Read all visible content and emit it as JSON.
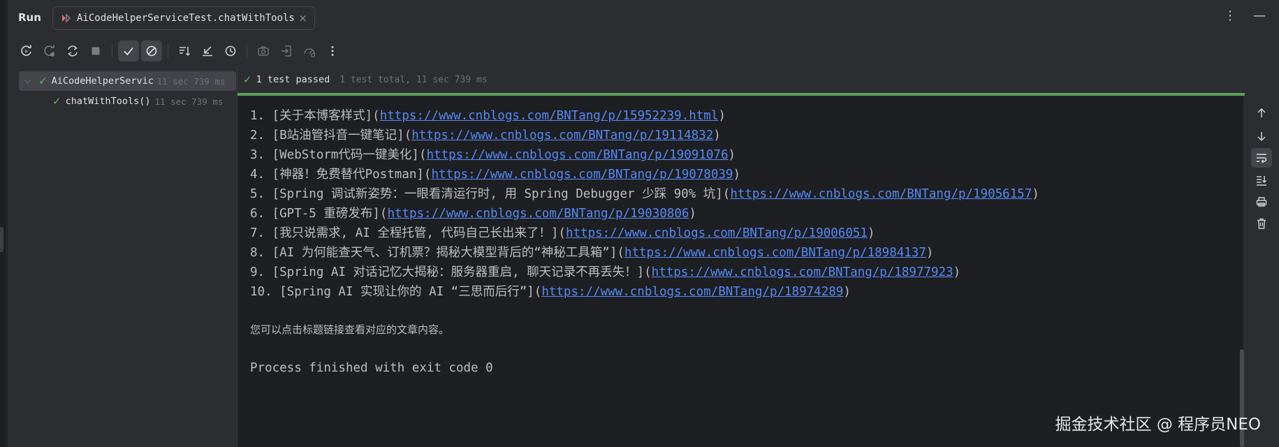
{
  "header": {
    "run_label": "Run",
    "tab_label": "AiCodeHelperServiceTest.chatWithTools",
    "close_glyph": "×",
    "more_glyph": "⋮",
    "minimize_glyph": "—"
  },
  "toolbar": {
    "buttons": [
      {
        "icon": "rerun-icon"
      },
      {
        "icon": "rerun-failed-icon"
      },
      {
        "icon": "toggle-auto-test-icon"
      },
      {
        "icon": "stop-icon"
      },
      {
        "icon": "show-passed-icon",
        "active": true
      },
      {
        "icon": "show-ignored-icon",
        "active": true
      },
      {
        "icon": "sort-alphabetically-icon"
      },
      {
        "icon": "sort-by-duration-icon"
      },
      {
        "icon": "history-icon"
      },
      {
        "icon": "camera-icon"
      },
      {
        "icon": "import-tests-icon"
      },
      {
        "icon": "coverage-icon"
      },
      {
        "icon": "more-options-icon"
      }
    ]
  },
  "tree": {
    "root": {
      "name": "AiCodeHelperServiceTest",
      "duration": "11 sec 739 ms"
    },
    "child": {
      "name": "chatWithTools()",
      "duration": "11 sec 739 ms"
    }
  },
  "status": {
    "passed": "1 test passed",
    "total": "1 test total, 11 sec 739 ms"
  },
  "console": {
    "items": [
      {
        "prefix": "1. [关于本博客样式](",
        "url": "https://www.cnblogs.com/BNTang/p/15952239.html",
        "suffix": ")"
      },
      {
        "prefix": "2. [B站油管抖音一键笔记](",
        "url": "https://www.cnblogs.com/BNTang/p/19114832",
        "suffix": ")"
      },
      {
        "prefix": "3. [WebStorm代码一键美化](",
        "url": "https://www.cnblogs.com/BNTang/p/19091076",
        "suffix": ")"
      },
      {
        "prefix": "4. [神器！免费替代Postman](",
        "url": "https://www.cnblogs.com/BNTang/p/19078039",
        "suffix": ")"
      },
      {
        "prefix": "5. [Spring 调试新姿势：一眼看清运行时, 用 Spring Debugger 少踩 90% 坑](",
        "url": "https://www.cnblogs.com/BNTang/p/19056157",
        "suffix": ")"
      },
      {
        "prefix": "6. [GPT-5 重磅发布](",
        "url": "https://www.cnblogs.com/BNTang/p/19030806",
        "suffix": ")"
      },
      {
        "prefix": "7. [我只说需求, AI 全程托管, 代码自己长出来了！](",
        "url": "https://www.cnblogs.com/BNTang/p/19006051",
        "suffix": ")"
      },
      {
        "prefix": "8. [AI 为何能查天气、订机票？揭秘大模型背后的“神秘工具箱”](",
        "url": "https://www.cnblogs.com/BNTang/p/18984137",
        "suffix": ")"
      },
      {
        "prefix": "9. [Spring AI 对话记忆大揭秘：服务器重启, 聊天记录不再丢失！](",
        "url": "https://www.cnblogs.com/BNTang/p/18977923",
        "suffix": ")"
      },
      {
        "prefix": "10. [Spring AI 实现让你的 AI “三思而后行”](",
        "url": "https://www.cnblogs.com/BNTang/p/18974289",
        "suffix": ")"
      }
    ],
    "note": "您可以点击标题链接查看对应的文章内容。",
    "finished": "Process finished with exit code 0"
  },
  "watermark": "掘金技术社区 @ 程序员NEO",
  "right_toolbar": [
    {
      "icon": "scroll-up-icon"
    },
    {
      "icon": "scroll-down-icon"
    },
    {
      "icon": "soft-wrap-icon",
      "active": true
    },
    {
      "icon": "scroll-to-end-icon"
    },
    {
      "icon": "print-icon"
    },
    {
      "icon": "clear-all-icon"
    }
  ],
  "colors": {
    "success": "#5fb865",
    "link": "#548af7",
    "progress": "#5c9e5c"
  }
}
